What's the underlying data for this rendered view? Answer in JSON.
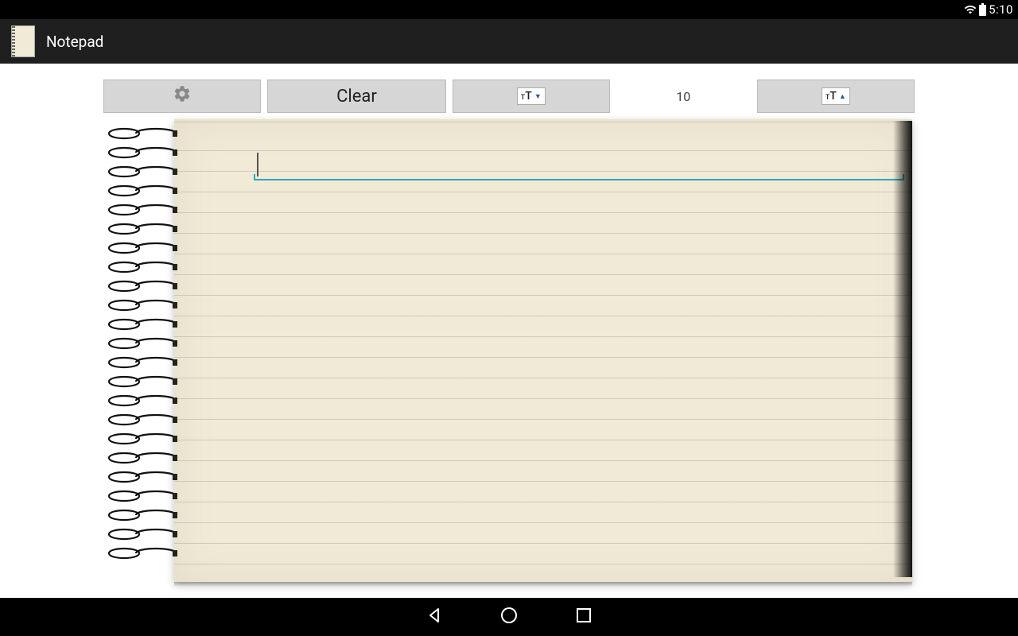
{
  "status": {
    "time": "5:10"
  },
  "app": {
    "title": "Notepad"
  },
  "toolbar": {
    "clear_label": "Clear",
    "font_size_value": "10"
  },
  "note": {
    "content": ""
  }
}
